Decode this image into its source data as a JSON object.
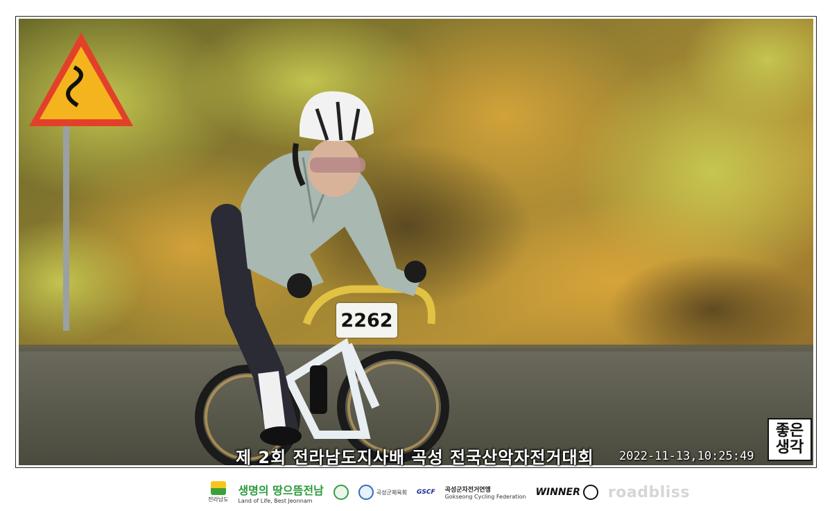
{
  "photo": {
    "description_hidden": "",
    "caption": "제 2회 전라남도지사배 곡성 전국산악자전거대회",
    "timestamp": "2022-11-13,10:25:49",
    "bib_number": "2262",
    "watermark_stamp": [
      "좋은",
      "생각"
    ]
  },
  "sponsors": {
    "jeonnam": "전라남도",
    "slogan_main": "생명의 땅으뜸전남",
    "slogan_sub": "Land of Life, Best Jeonnam",
    "gokseong_sports": "곡성군체육회",
    "gscf": "GSCF",
    "federation_kr": "곡성군자전거연맹",
    "federation_en": "Gokseong Cycling Federation",
    "winner": "WINNER",
    "roadbliss": "roadbliss"
  },
  "colors": {
    "jersey": "#a9b8b0",
    "helmet": "#f2f2f2",
    "foliage_gold": "#c9a23a",
    "sign_red": "#e3402a",
    "sign_yellow": "#f4b41e"
  }
}
